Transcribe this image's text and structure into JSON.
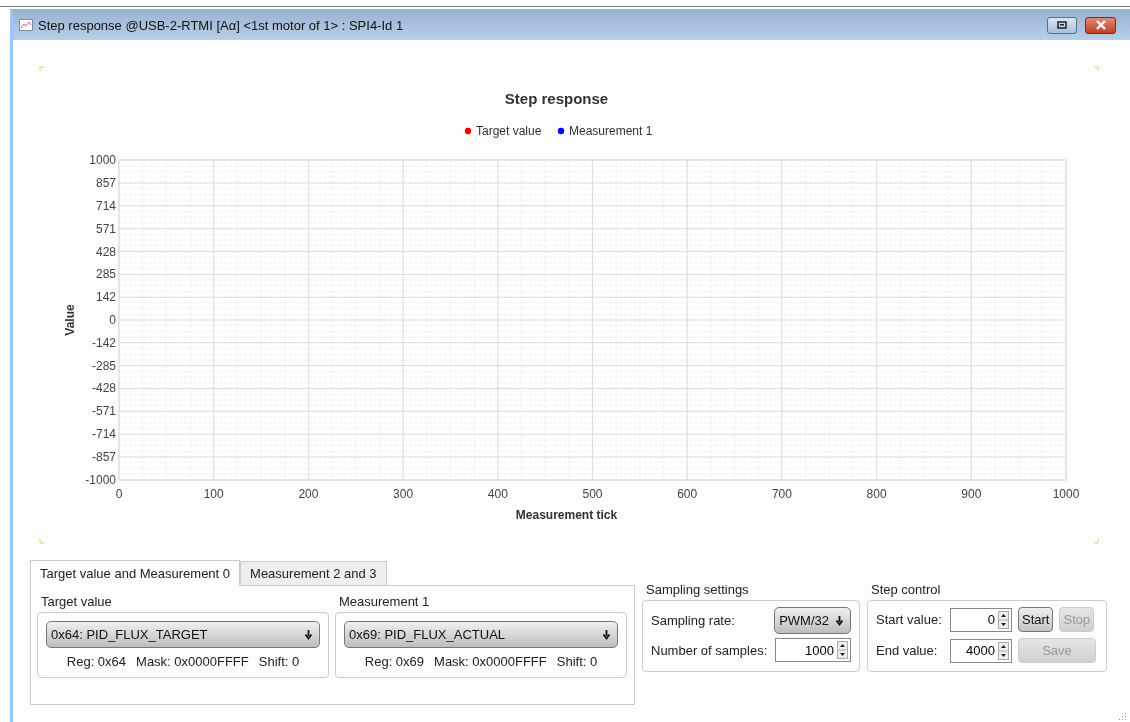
{
  "window": {
    "title": "Step response @USB-2-RTMI [Aα] <1st motor of 1> : SPI4-Id 1"
  },
  "chart": {
    "chart_data": {
      "type": "line",
      "title": "Step response",
      "xlabel": "Measurement tick",
      "ylabel": "Value",
      "series": [
        {
          "name": "Target value",
          "color": "#ff0000",
          "values": [
            null,
            null,
            null,
            null,
            null,
            null,
            null,
            null,
            null,
            null,
            null
          ]
        },
        {
          "name": "Measurement 1",
          "color": "#0000ff",
          "values": [
            null,
            null,
            null,
            null,
            null,
            null,
            null,
            null,
            null,
            null,
            null
          ]
        }
      ],
      "ylim": [
        -1000,
        1000
      ],
      "grid": true,
      "categories": [
        "0",
        "100",
        "200",
        "300",
        "400",
        "500",
        "600",
        "700",
        "800",
        "900",
        "1000"
      ],
      "yticks": [
        1000,
        857,
        714,
        571,
        428,
        285,
        142,
        0,
        -142,
        -285,
        -428,
        -571,
        -714,
        -857,
        -1000
      ]
    }
  },
  "tabs": [
    {
      "label": "Target value and Measurement 0",
      "selected": true
    },
    {
      "label": "Measurement 2 and 3",
      "selected": false
    }
  ],
  "channels": [
    {
      "title": "Target value",
      "register": "0x64: PID_FLUX_TARGET",
      "reg": "Reg: 0x64",
      "mask": "Mask: 0x0000FFFF",
      "shift": "Shift: 0"
    },
    {
      "title": "Measurement 1",
      "register": "0x69: PID_FLUX_ACTUAL",
      "reg": "Reg: 0x69",
      "mask": "Mask: 0x0000FFFF",
      "shift": "Shift: 0"
    }
  ],
  "sampling": {
    "title": "Sampling settings",
    "rate_label": "Sampling rate:",
    "rate": "PWM/32",
    "samples_label": "Number of samples:",
    "samples": "1000"
  },
  "step_control": {
    "title": "Step control",
    "start_label": "Start value:",
    "start": "0",
    "end_label": "End value:",
    "end": "4000",
    "buttons": [
      {
        "label": "Start",
        "disabled": false
      },
      {
        "label": "Stop",
        "disabled": true
      },
      {
        "label": "Save",
        "disabled": true
      }
    ]
  }
}
